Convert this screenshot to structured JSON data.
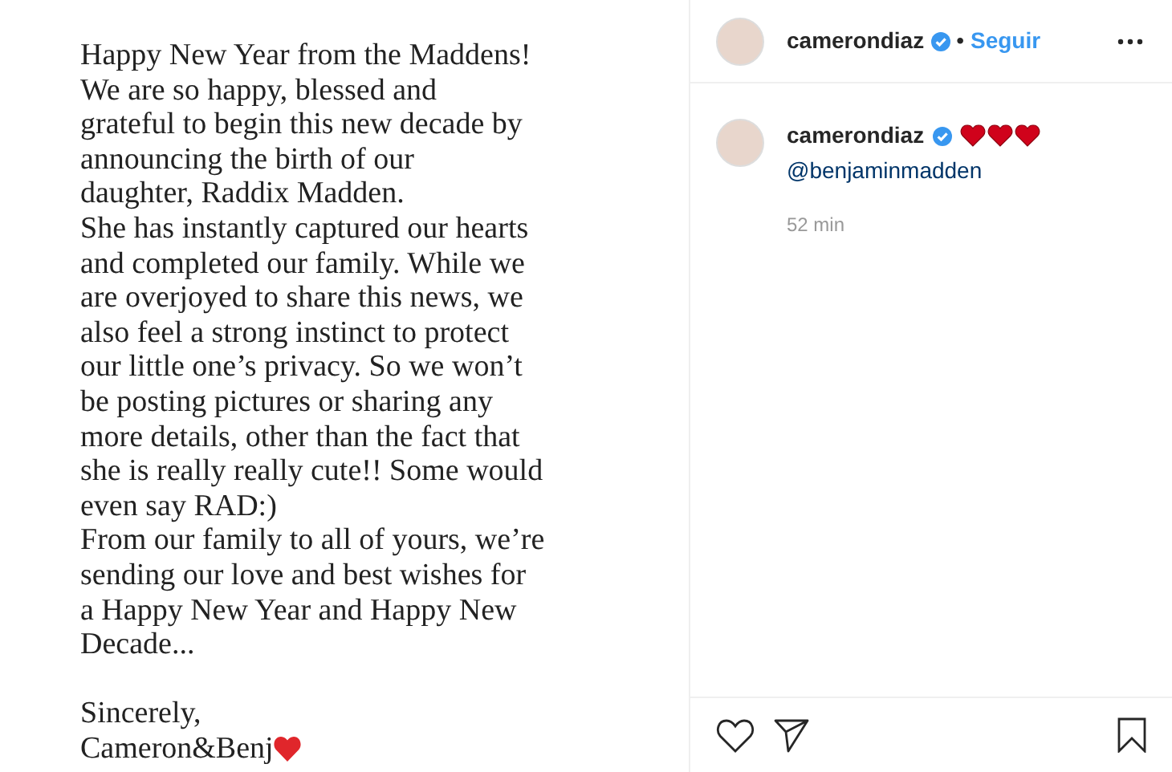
{
  "post_image": {
    "lines": [
      "Happy New Year from the Maddens!",
      "We are so happy, blessed and",
      "grateful to begin this new decade by",
      "announcing the birth of our",
      "daughter, Raddix Madden.",
      "She has instantly captured our hearts",
      "and completed our family. While we",
      "are overjoyed to share this news, we",
      "also feel a strong instinct to protect",
      "our little one’s privacy. So we won’t",
      "be posting pictures or sharing any",
      "more details, other than the fact that",
      "she is really really cute!! Some would",
      "even say RAD:)",
      "From our family to all of yours, we’re",
      "sending our love and best wishes for",
      "a Happy New Year and Happy New",
      "Decade..."
    ],
    "signoff": [
      "Sincerely,",
      "Cameron&Benj"
    ]
  },
  "header": {
    "username": "camerondiaz",
    "separator": "•",
    "follow": "Seguir"
  },
  "comment": {
    "username": "camerondiaz",
    "mention": "@benjaminmadden",
    "time": "52 min"
  }
}
